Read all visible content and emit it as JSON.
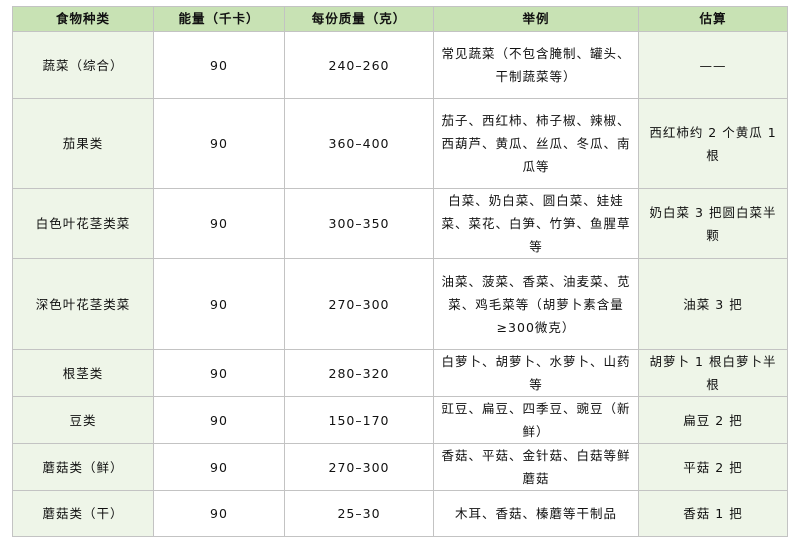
{
  "headers": [
    "食物种类",
    "能量（千卡）",
    "每份质量（克）",
    "举例",
    "估算"
  ],
  "rows": [
    {
      "category": "蔬菜（综合）",
      "energy": "90",
      "mass": "240–260",
      "examples": "常见蔬菜（不包含腌制、罐头、干制蔬菜等）",
      "estimate": "——"
    },
    {
      "category": "茄果类",
      "energy": "90",
      "mass": "360–400",
      "examples": "茄子、西红柿、柿子椒、辣椒、西葫芦、黄瓜、丝瓜、冬瓜、南瓜等",
      "estimate": "西红柿约 2 个黄瓜 1 根"
    },
    {
      "category": "白色叶花茎类菜",
      "energy": "90",
      "mass": "300–350",
      "examples": "白菜、奶白菜、圆白菜、娃娃菜、菜花、白笋、竹笋、鱼腥草等",
      "estimate": "奶白菜 3 把圆白菜半颗"
    },
    {
      "category": "深色叶花茎类菜",
      "energy": "90",
      "mass": "270–300",
      "examples": "油菜、菠菜、香菜、油麦菜、苋菜、鸡毛菜等（胡萝卜素含量≥300微克）",
      "estimate": "油菜 3 把"
    },
    {
      "category": "根茎类",
      "energy": "90",
      "mass": "280–320",
      "examples": "白萝卜、胡萝卜、水萝卜、山药等",
      "estimate": "胡萝卜 1 根白萝卜半根"
    },
    {
      "category": "豆类",
      "energy": "90",
      "mass": "150–170",
      "examples": "豇豆、扁豆、四季豆、豌豆（新鲜）",
      "estimate": "扁豆 2 把"
    },
    {
      "category": "蘑菇类（鲜）",
      "energy": "90",
      "mass": "270–300",
      "examples": "香菇、平菇、金针菇、白菇等鲜蘑菇",
      "estimate": "平菇 2 把"
    },
    {
      "category": "蘑菇类（干）",
      "energy": "90",
      "mass": "25–30",
      "examples": "木耳、香菇、榛蘑等干制品",
      "estimate": "香菇 1 把"
    }
  ]
}
